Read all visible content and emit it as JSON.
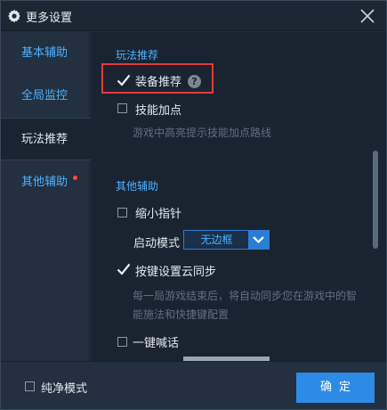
{
  "window": {
    "title": "更多设置"
  },
  "sidebar": {
    "items": [
      {
        "label": "基本辅助"
      },
      {
        "label": "全局监控"
      },
      {
        "label": "玩法推荐"
      },
      {
        "label": "其他辅助"
      }
    ]
  },
  "content": {
    "section1": {
      "title": "玩法推荐",
      "options": [
        {
          "label": "装备推荐",
          "checked": true
        },
        {
          "label": "技能加点",
          "checked": false,
          "description": "游戏中高亮提示技能加点路线"
        }
      ]
    },
    "section2": {
      "title": "其他辅助",
      "options": [
        {
          "label": "缩小指针",
          "checked": false
        },
        {
          "label": "按键设置云同步",
          "checked": true,
          "description_line1": "每一局游戏结束后，将自动同步您在游戏中的智",
          "description_line2": "能施法和快捷键配置"
        },
        {
          "label": "一键喊话",
          "checked": false
        }
      ],
      "launch_mode_label": "启动模式",
      "launch_mode_value": "无边框"
    }
  },
  "footer": {
    "pure_mode_label": "纯净模式",
    "confirm_label": "确定"
  },
  "colors": {
    "accent": "#4fb0ff",
    "button": "#2d8be6",
    "highlight": "#e43a3a",
    "badge": "#ff4a3d"
  }
}
